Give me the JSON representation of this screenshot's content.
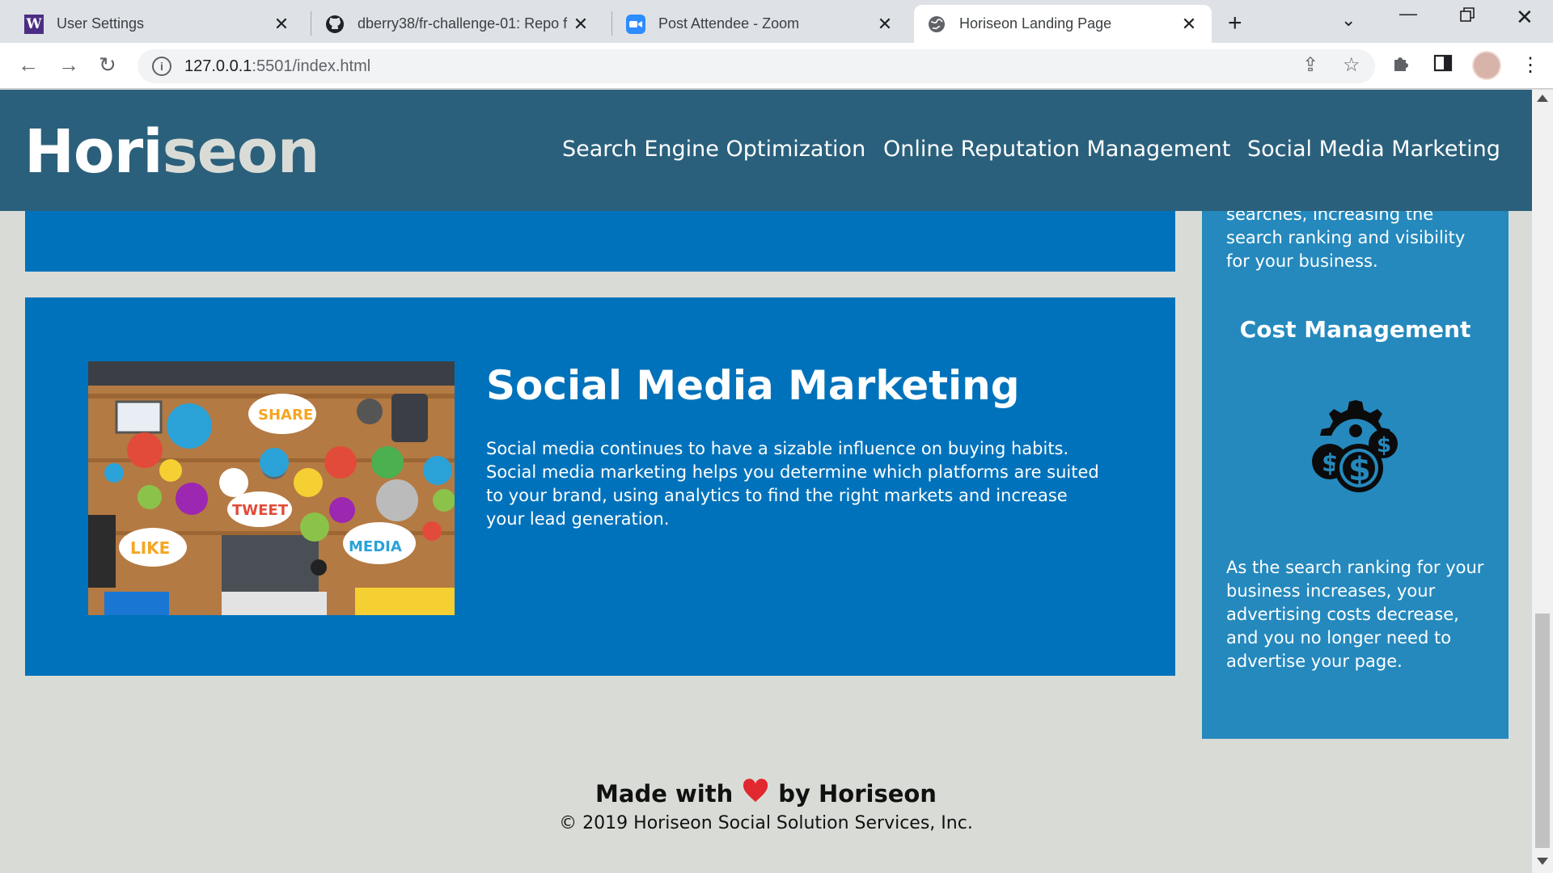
{
  "browser": {
    "tabs": [
      {
        "title": "User Settings"
      },
      {
        "title": "dberry38/fr-challenge-01: Repo f"
      },
      {
        "title": "Post Attendee - Zoom"
      },
      {
        "title": "Horiseon Landing Page"
      }
    ],
    "url_host": "127.0.0.1",
    "url_path": ":5501/index.html"
  },
  "header": {
    "logo_main": "Hori",
    "logo_accent": "seon",
    "nav": [
      "Search Engine Optimization",
      "Online Reputation Management",
      "Social Media Marketing"
    ]
  },
  "social": {
    "title": "Social Media Marketing",
    "text": "Social media continues to have a sizable influence on buying habits. Social media marketing helps you determine which platforms are suited to your brand, using analytics to find the right markets and increase your lead generation.",
    "image_words": [
      "SHARE",
      "TWEET",
      "LIKE",
      "MEDIA"
    ]
  },
  "aside": {
    "text_top": "searches, increasing the search ranking and visibility for your business.",
    "title": "Cost Management",
    "text_bottom": "As the search ranking for your business increases, your advertising costs decrease, and you no longer need to advertise your page."
  },
  "footer": {
    "made_with": "Made with",
    "by": "by Horiseon",
    "copyright": "© 2019 Horiseon Social Solution Services, Inc."
  },
  "colors": {
    "header": "#2a607c",
    "content": "#0072bb",
    "aside": "#2589bd",
    "background": "#d9dcd6",
    "heart": "#e0282e"
  }
}
